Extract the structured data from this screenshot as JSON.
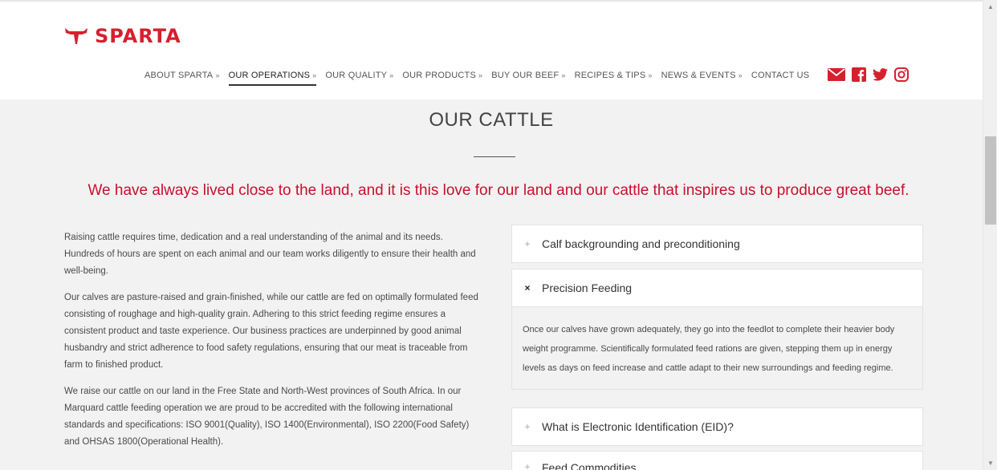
{
  "header": {
    "brand": "SPARTA",
    "nav": [
      {
        "label": "ABOUT SPARTA",
        "active": false
      },
      {
        "label": "OUR OPERATIONS",
        "active": true
      },
      {
        "label": "OUR QUALITY",
        "active": false
      },
      {
        "label": "OUR PRODUCTS",
        "active": false
      },
      {
        "label": "BUY OUR BEEF",
        "active": false
      },
      {
        "label": "RECIPES & TIPS",
        "active": false
      },
      {
        "label": "NEWS & EVENTS",
        "active": false
      },
      {
        "label": "CONTACT US",
        "active": false
      }
    ],
    "chevron": "»",
    "social": [
      "mail-icon",
      "facebook-icon",
      "twitter-icon",
      "instagram-icon"
    ]
  },
  "page": {
    "title": "OUR CATTLE",
    "tagline": "We have always lived close to the land, and it is this love for our land and our cattle that inspires us to produce great beef.",
    "paragraphs": [
      "Raising cattle requires time, dedication and a real understanding of the animal and its needs. Hundreds of hours are spent on each animal and our team works diligently to ensure their health and well-being.",
      "Our calves are pasture-raised and grain-finished, while our cattle are fed on optimally formulated feed consisting of roughage and high-quality grain. Adhering to this strict feeding regime ensures a consistent product and taste experience. Our business practices are underpinned by good animal husbandry and strict adherence to food safety regulations, ensuring that our meat is traceable from farm to finished product.",
      "We raise our cattle on our land in the Free State and North-West provinces of South Africa. In our Marquard cattle feeding operation we are proud to be accredited with the following international standards and specifications: ISO 9001(Quality), ISO 1400(Environmental), ISO 2200(Food Safety) and OHSAS 1800(Operational Health)."
    ]
  },
  "accordion": [
    {
      "label": "Calf backgrounding and preconditioning",
      "open": false
    },
    {
      "label": "Precision Feeding",
      "open": true,
      "body": "Once our calves have grown adequately, they go into the feedlot to complete their heavier body weight programme. Scientifically formulated feed rations are given, stepping them up in energy levels as days on feed increase and cattle adapt to their new surroundings and feeding regime."
    },
    {
      "label": "What is Electronic Identification (EID)?",
      "open": false
    },
    {
      "label": "Feed Commodities",
      "open": false
    }
  ],
  "symbols": {
    "collapsed": "+",
    "expanded": "×"
  },
  "colors": {
    "brand_red": "#d6202e",
    "tagline_red": "#c8102e"
  }
}
